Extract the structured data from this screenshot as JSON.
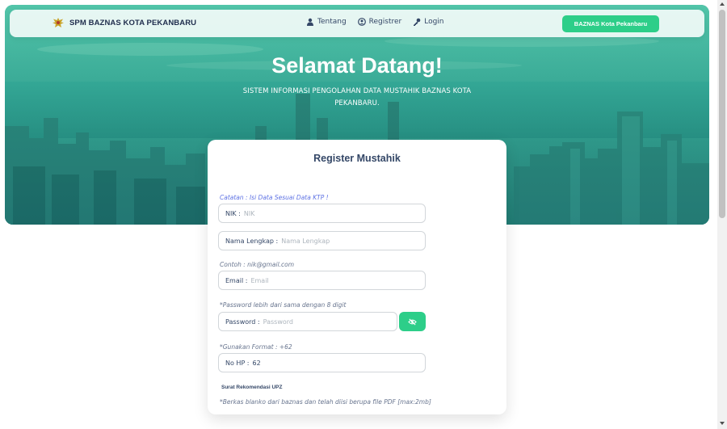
{
  "navbar": {
    "brand": "SPM BAZNAS KOTA PEKANBARU",
    "links": [
      {
        "label": "Tentang",
        "icon": "user-icon"
      },
      {
        "label": "Registrer",
        "icon": "user-circle-icon"
      },
      {
        "label": "Login",
        "icon": "key-icon"
      }
    ],
    "cta": "BAZNAS Kota Pekanbaru"
  },
  "hero": {
    "title": "Selamat Datang!",
    "subtitle": "SISTEM INFORMASI PENGOLAHAN DATA MUSTAHIK BAZNAS KOTA PEKANBARU."
  },
  "form": {
    "title": "Register Mustahik",
    "nik_note": "Catatan : Isi Data Sesuai Data KTP !",
    "nik_label": "NIK :",
    "nik_placeholder": "NIK",
    "name_label": "Nama Lengkap :",
    "name_placeholder": "Nama Lengkap",
    "email_note": "Contoh : nik@gmail.com",
    "email_label": "Email :",
    "email_placeholder": "Email",
    "password_note": "*Password lebih dari sama dengan 8 digit",
    "password_label": "Password :",
    "password_placeholder": "Password",
    "phone_note": "*Gunakan Format : +62",
    "phone_label": "No HP :",
    "phone_value": "62",
    "upz_label": "Surat Rekomendasi UPZ",
    "upz_note": "*Berkas blanko dari baznas dan telah diisi berupa file PDF [max:2mb]"
  },
  "colors": {
    "accent": "#2dce89",
    "hero": "#2f8f8a",
    "note_blue": "#5e72e4"
  }
}
